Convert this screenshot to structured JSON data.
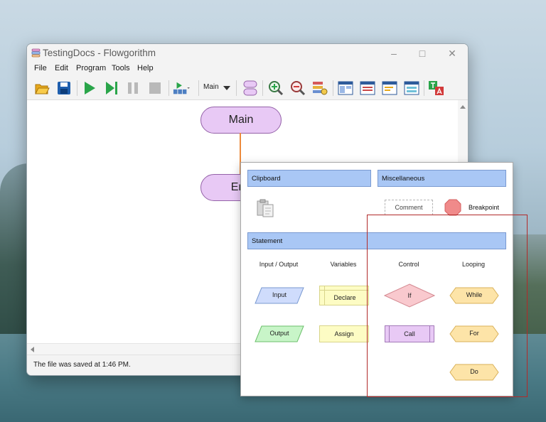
{
  "window": {
    "title": "TestingDocs - Flowgorithm",
    "controls": [
      "minimize",
      "maximize",
      "close"
    ]
  },
  "menu": [
    "File",
    "Edit",
    "Program",
    "Tools",
    "Help"
  ],
  "toolbar": {
    "icons": [
      "open-icon",
      "save-icon",
      "run-icon",
      "step-icon",
      "pause-icon",
      "stop-icon",
      "run-speed-icon",
      "functions-icon",
      "zoom-in-icon",
      "zoom-out-icon",
      "variable-watch-icon",
      "layout-icon",
      "console-icon",
      "source-view-icon",
      "drawing-window-icon",
      "translate-icon"
    ],
    "function_selector": "Main"
  },
  "flowchart": {
    "start_label": "Main",
    "end_label": "End"
  },
  "status": "The file was saved at 1:46 PM.",
  "palette": {
    "clipboard_header": "Clipboard",
    "misc_header": "Miscellaneous",
    "comment_label": "Comment",
    "breakpoint_label": "Breakpoint",
    "statement_header": "Statement",
    "columns": [
      "Input / Output",
      "Variables",
      "Control",
      "Looping"
    ],
    "input_label": "Input",
    "output_label": "Output",
    "declare_label": "Declare",
    "assign_label": "Assign",
    "if_label": "If",
    "call_label": "Call",
    "while_label": "While",
    "for_label": "For",
    "do_label": "Do"
  },
  "colors": {
    "header_fill": "#a9c7f5",
    "input_fill": "#cfdcfc",
    "output_fill": "#c8f5c8",
    "variable_fill": "#fdfcc4",
    "if_fill": "#f9c9ce",
    "call_fill": "#e8c9f5",
    "loop_fill": "#fde4a8",
    "highlight": "#b22a2a"
  }
}
